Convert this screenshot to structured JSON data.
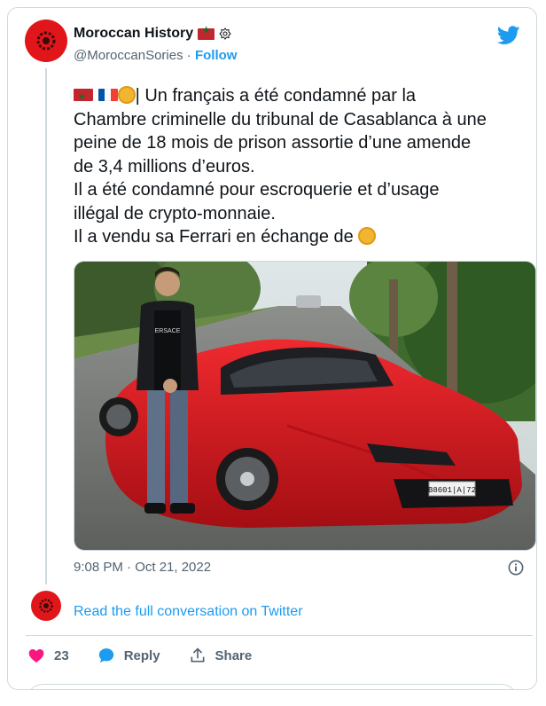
{
  "account": {
    "name": "Moroccan History",
    "handle": "@MoroccanSories",
    "separator": " · ",
    "follow_label": "Follow"
  },
  "tweet": {
    "lines": [
      "| Un français a été condamné par la",
      "Chambre criminelle du tribunal de Casablanca à une",
      "peine de 18 mois de prison assortie d’une amende",
      "de 3,4 millions d’euros.",
      "Il a été condamné pour escroquerie et d’usage",
      "illégal de crypto-monnaie.",
      "Il a vendu sa Ferrari en échange de"
    ],
    "plate_text": "B8601|A|72"
  },
  "meta": {
    "timestamp": "9:08 PM · Oct 21, 2022"
  },
  "links": {
    "read_conversation": "Read the full conversation on Twitter"
  },
  "actions": {
    "like_count": "23",
    "reply_label": "Reply",
    "share_label": "Share"
  },
  "colors": {
    "accent": "#1d9bf0",
    "like": "#f91880",
    "avatar": "#e0161b",
    "ferrari": "#d4141c"
  },
  "icons": [
    "twitter-bird-icon",
    "verified-badge-icon",
    "info-icon",
    "heart-icon",
    "reply-bubble-icon",
    "share-icon",
    "gold-coin-icon"
  ]
}
